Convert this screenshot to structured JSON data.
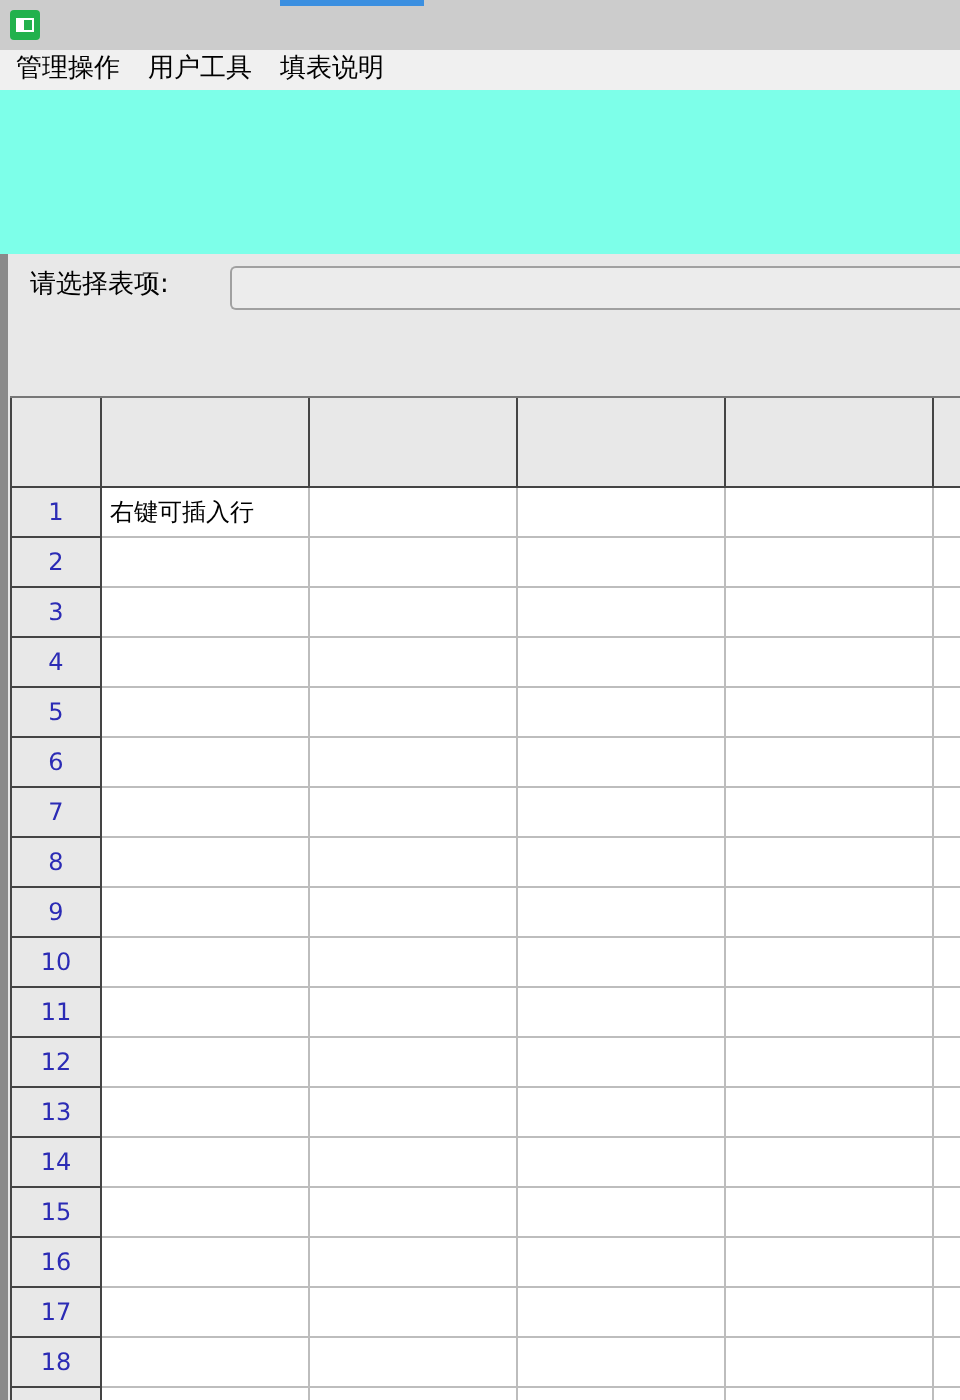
{
  "menu": [
    "管理操作",
    "用户工具",
    "填表说明"
  ],
  "selector": {
    "label": "请选择表项:"
  },
  "table": {
    "rows": [
      {
        "number": "1",
        "cells": [
          "右键可插入行"
        ]
      },
      {
        "number": "2",
        "cells": []
      },
      {
        "number": "3",
        "cells": []
      },
      {
        "number": "4",
        "cells": []
      },
      {
        "number": "5",
        "cells": []
      },
      {
        "number": "6",
        "cells": []
      },
      {
        "number": "7",
        "cells": []
      },
      {
        "number": "8",
        "cells": []
      },
      {
        "number": "9",
        "cells": []
      },
      {
        "number": "10",
        "cells": []
      },
      {
        "number": "11",
        "cells": []
      },
      {
        "number": "12",
        "cells": []
      },
      {
        "number": "13",
        "cells": []
      },
      {
        "number": "14",
        "cells": []
      },
      {
        "number": "15",
        "cells": []
      },
      {
        "number": "16",
        "cells": []
      },
      {
        "number": "17",
        "cells": []
      },
      {
        "number": "18",
        "cells": []
      }
    ]
  }
}
